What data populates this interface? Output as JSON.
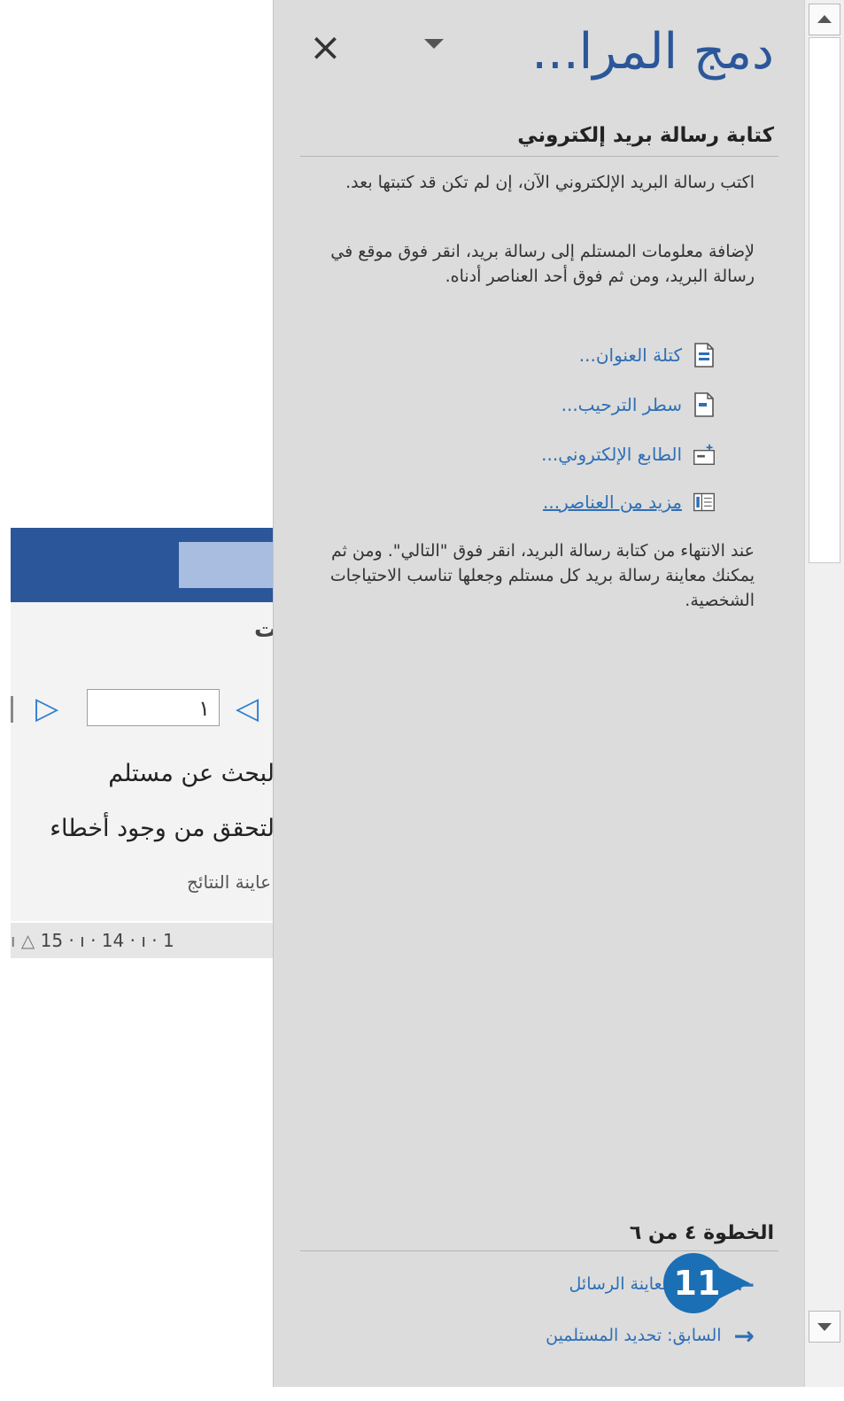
{
  "background_window": {
    "group_label": "ات",
    "record_number": "١",
    "find_recipient": "لبحث عن مستلم",
    "check_errors": "لتحقق من وجود أخطاء",
    "preview_caption": "عاينة النتائج",
    "ruler_text": "15 · ı · 14 · ı · 1",
    "ruler_indent": "ı △"
  },
  "task_pane": {
    "title": "دمج المرا...",
    "close_icon": "close-icon",
    "dropdown_icon": "chevron-down-icon",
    "section_heading": "كتابة رسالة بريد إلكتروني",
    "instructions_1": "اكتب رسالة البريد الإلكتروني الآن، إن لم تكن قد كتبتها بعد.",
    "instructions_2": "لإضافة معلومات المستلم إلى رسالة بريد، انقر فوق موقع في رسالة البريد، ومن ثم فوق أحد العناصر أدناه.",
    "links": [
      {
        "label": "كتلة العنوان...",
        "icon": "address-block-icon"
      },
      {
        "label": "سطر الترحيب...",
        "icon": "greeting-line-icon"
      },
      {
        "label": "الطابع الإلكتروني...",
        "icon": "electronic-postage-icon"
      },
      {
        "label": "مزيد من العناصر...",
        "icon": "more-items-icon"
      }
    ],
    "instructions_3": "عند الانتهاء من كتابة رسالة البريد، انقر فوق \"التالي\". ومن ثم يمكنك معاينة رسالة بريد كل مستلم وجعلها تناسب الاحتياجات الشخصية.",
    "step_text": "الخطوة ٤ من ٦",
    "next_link": "التالي: معاينة الرسائل",
    "prev_link": "السابق: تحديد المستلمين"
  },
  "callout": {
    "number": "11"
  },
  "colors": {
    "accent_blue": "#2b579a",
    "link_blue": "#2e6fb6",
    "pane_background": "#dcdcdc",
    "callout_blue": "#1b6fb5"
  }
}
